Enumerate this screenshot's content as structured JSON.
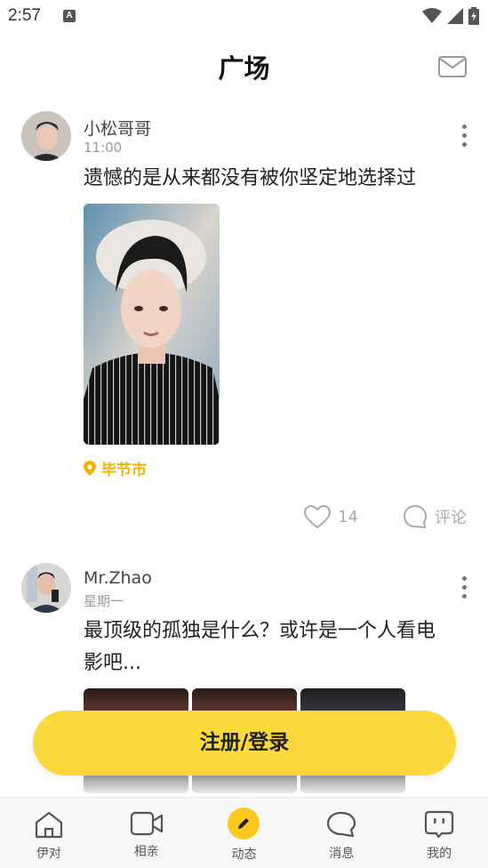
{
  "status_bar": {
    "time": "2:57",
    "notification_letter": "A"
  },
  "header": {
    "title": "广场"
  },
  "posts": [
    {
      "username": "小松哥哥",
      "time": "11:00",
      "text": "遗憾的是从来都没有被你坚定地选择过",
      "location": "毕节市",
      "likes": "14",
      "comment_label": "评论"
    },
    {
      "username": "Mr.Zhao",
      "time": "星期一",
      "text": "最顶级的孤独是什么？或许是一个人看电影吧..."
    }
  ],
  "register_button": {
    "label": "注册/登录"
  },
  "bottom_nav": {
    "items": [
      {
        "label": "伊对",
        "icon": "home-icon"
      },
      {
        "label": "相亲",
        "icon": "video-icon"
      },
      {
        "label": "动态",
        "icon": "pencil-icon",
        "active": true
      },
      {
        "label": "消息",
        "icon": "chat-icon"
      },
      {
        "label": "我的",
        "icon": "profile-icon"
      }
    ]
  },
  "colors": {
    "accent": "#fcd93b",
    "location": "#f0b400"
  }
}
